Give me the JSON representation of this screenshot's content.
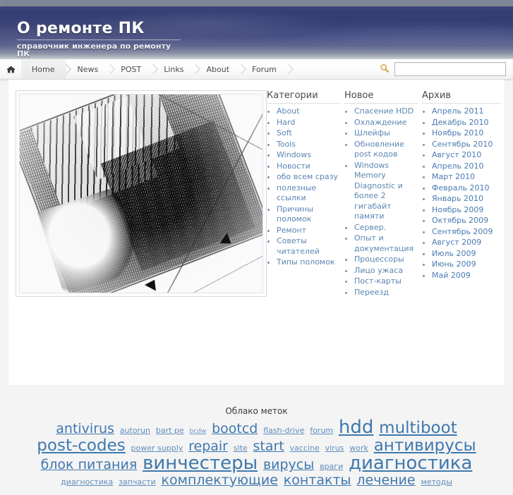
{
  "site": {
    "title": "О ремонте ПК",
    "tagline": "справочник инженера по ремонту ПК"
  },
  "nav": {
    "home_icon": "home-icon",
    "items": [
      {
        "label": "Home",
        "active": true
      },
      {
        "label": "News",
        "active": false
      },
      {
        "label": "POST",
        "active": false
      },
      {
        "label": "Links",
        "active": false
      },
      {
        "label": "About",
        "active": false
      },
      {
        "label": "Forum",
        "active": false
      }
    ]
  },
  "search": {
    "icon": "search-icon",
    "value": "",
    "placeholder": ""
  },
  "widgets": [
    {
      "id": "categories",
      "title": "Категории",
      "items": [
        "About",
        "Hard",
        "Soft",
        "Tools",
        "Windows",
        "Новости",
        "обо всем сразу",
        "полезные ссылки",
        "Причины поломок",
        "Ремонт",
        "Советы читателей",
        "Типы поломок"
      ]
    },
    {
      "id": "new",
      "title": "Новое",
      "items": [
        "Спасение HDD",
        "Охлаждение",
        "Шлейфы",
        "Обновление post кодов",
        "Windows Memory Diagnostic и более 2 гигабайт памяти",
        "Сервер.",
        "Опыт и документация",
        "Процессоры",
        "Лицо ужаса",
        "Пост-карты",
        "Переезд"
      ]
    },
    {
      "id": "archive",
      "title": "Архив",
      "items": [
        "Апрель 2011",
        "Декабрь 2010",
        "Ноябрь 2010",
        "Сентябрь 2010",
        "Август 2010",
        "Апрель 2010",
        "Март 2010",
        "Февраль 2010",
        "Январь 2010",
        "Ноябрь 2009",
        "Октябрь 2009",
        "Сентябрь 2009",
        "Август 2009",
        "Июль 2009",
        "Июнь 2009",
        "Май 2009"
      ]
    }
  ],
  "tagcloud": {
    "title": "Облако меток",
    "tags": [
      {
        "label": "antivirus",
        "size": 5
      },
      {
        "label": "autorun",
        "size": 2
      },
      {
        "label": "bart pe",
        "size": 2
      },
      {
        "label": "bcdw",
        "size": 1
      },
      {
        "label": "bootcd",
        "size": 5
      },
      {
        "label": "flash-drive",
        "size": 2
      },
      {
        "label": "forum",
        "size": 2
      },
      {
        "label": "hdd",
        "size": 7
      },
      {
        "label": "multiboot",
        "size": 6
      },
      {
        "label": "post-codes",
        "size": 6
      },
      {
        "label": "power supply",
        "size": 2
      },
      {
        "label": "repair",
        "size": 5
      },
      {
        "label": "site",
        "size": 2
      },
      {
        "label": "start",
        "size": 5
      },
      {
        "label": "vaccine",
        "size": 2
      },
      {
        "label": "virus",
        "size": 2
      },
      {
        "label": "work",
        "size": 2
      },
      {
        "label": "антивирусы",
        "size": 6
      },
      {
        "label": "блок питания",
        "size": 5
      },
      {
        "label": "винчестеры",
        "size": 7
      },
      {
        "label": "вирусы",
        "size": 5
      },
      {
        "label": "враги",
        "size": 2
      },
      {
        "label": "диагностика",
        "size": 7
      },
      {
        "label": "диагностика",
        "size": 2
      },
      {
        "label": "запчасти",
        "size": 2
      },
      {
        "label": "комплектующие",
        "size": 5
      },
      {
        "label": "контакты",
        "size": 5
      },
      {
        "label": "лечение",
        "size": 5
      },
      {
        "label": "методы",
        "size": 2
      }
    ]
  },
  "photo": {
    "caption": "motherboard-halftone-photo"
  },
  "colors": {
    "banner_dark": "#2e3a72",
    "banner_top": "#7c8494",
    "link": "#5b86b3",
    "tag": "#3f78ad",
    "page_bg": "#f4f4f5",
    "content_bg": "#ffffff"
  }
}
